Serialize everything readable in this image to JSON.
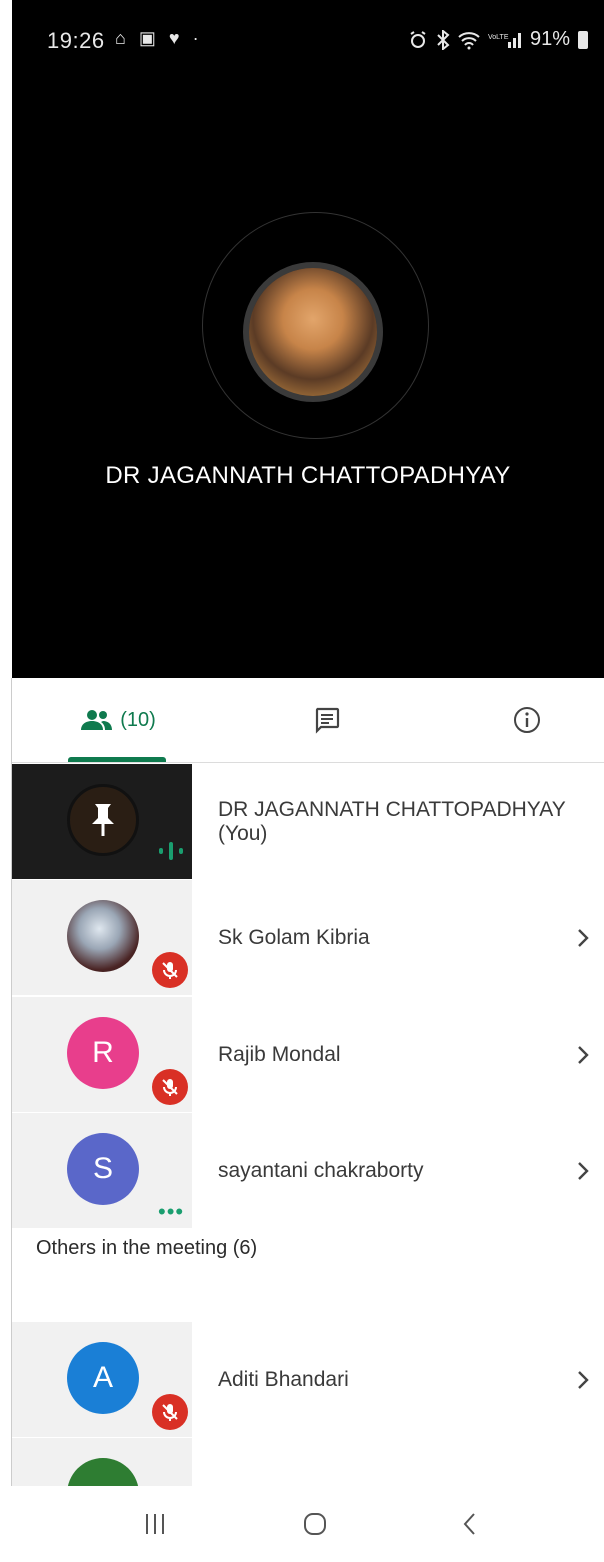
{
  "status_bar": {
    "time": "19:26",
    "left_icons": "⌂ ▣ ♥ ·",
    "battery": "91%"
  },
  "call": {
    "caller_name": "DR JAGANNATH CHATTOPADHYAY"
  },
  "tabs": {
    "people_count": "(10)",
    "chat_icon": "chat-icon",
    "info_icon": "info-icon",
    "accent_color": "#0f7a4e"
  },
  "participants": [
    {
      "name": "DR JAGANNATH CHATTOPADHYAY (You)",
      "avatar_type": "photo-pinned",
      "status": "speaking"
    },
    {
      "name": "Sk Golam Kibria",
      "avatar_type": "photo",
      "status": "muted"
    },
    {
      "name": "Rajib Mondal",
      "avatar_letter": "R",
      "avatar_color": "#e83e8c",
      "status": "muted"
    },
    {
      "name": "sayantani chakraborty",
      "avatar_letter": "S",
      "avatar_color": "#5a67c9",
      "status": "connecting"
    }
  ],
  "others_section": {
    "label": "Others in the meeting (6)",
    "participants": [
      {
        "name": "Aditi Bhandari",
        "avatar_letter": "A",
        "avatar_color": "#1a7fd6",
        "status": "muted"
      }
    ]
  },
  "colors": {
    "mute_red": "#d93025",
    "speaking_green": "#1a9e6f"
  }
}
